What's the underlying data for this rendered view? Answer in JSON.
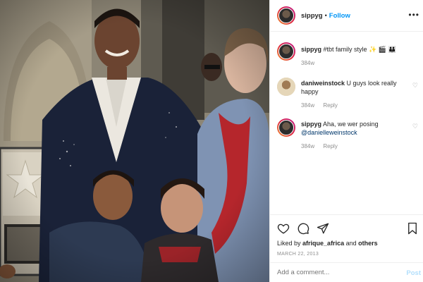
{
  "header": {
    "username": "sippyg",
    "separator": "•",
    "follow_label": "Follow",
    "more_icon": "more-options-icon"
  },
  "caption": {
    "username": "sippyg",
    "text": "#tbt family style",
    "emojis": "✨ 🎬 👪",
    "time": "384w"
  },
  "comments": [
    {
      "username": "daniweinstock",
      "text": "U guys look really happy",
      "time": "384w",
      "reply_label": "Reply"
    },
    {
      "username": "sippyg",
      "text": "Aha, we wer posing",
      "mention": "@danielleweinstock",
      "time": "384w",
      "reply_label": "Reply"
    }
  ],
  "actions": {
    "liked_by_prefix": "Liked by",
    "liked_by_user": "afrique_africa",
    "liked_by_joiner": "and",
    "liked_by_suffix": "others",
    "date": "MARCH 22, 2013"
  },
  "add_comment": {
    "placeholder": "Add a comment...",
    "post_label": "Post"
  },
  "colors": {
    "accent": "#0095f6",
    "muted": "#8e8e8e",
    "border": "#efefef"
  }
}
